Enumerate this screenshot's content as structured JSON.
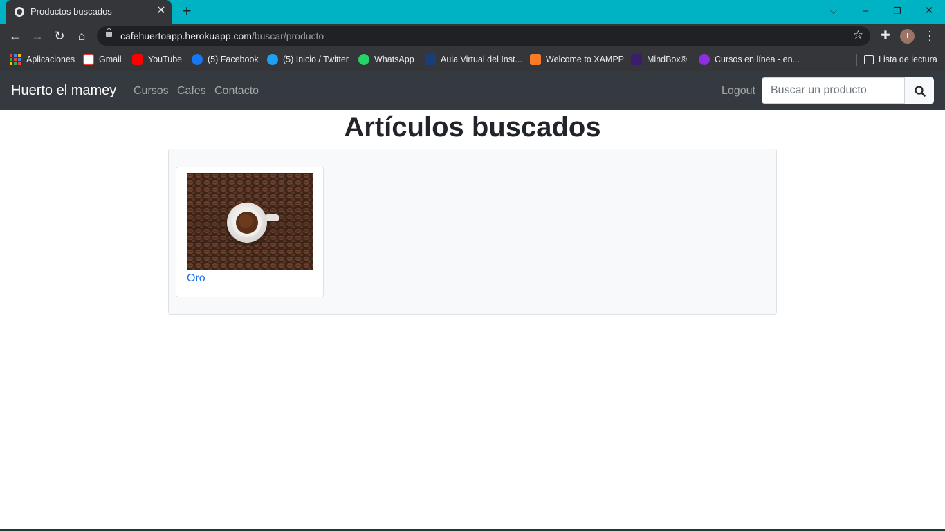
{
  "browser": {
    "tab": {
      "title": "Productos buscados"
    },
    "url": {
      "host": "cafehuertoapp.herokuapp.com",
      "path": "/buscar/producto"
    },
    "profile_initial": "I",
    "bookmarks": [
      {
        "label": "Aplicaciones",
        "icon": "apps-grid-icon"
      },
      {
        "label": "Gmail",
        "icon": "gmail-icon",
        "color": "#ea4335"
      },
      {
        "label": "YouTube",
        "icon": "youtube-icon",
        "color": "#ff0000"
      },
      {
        "label": "(5) Facebook",
        "icon": "facebook-icon",
        "color": "#1877f2"
      },
      {
        "label": "(5) Inicio / Twitter",
        "icon": "twitter-icon",
        "color": "#1da1f2"
      },
      {
        "label": "WhatsApp",
        "icon": "whatsapp-icon",
        "color": "#25d366"
      },
      {
        "label": "Aula Virtual del Inst...",
        "icon": "aula-virtual-icon",
        "color": "#1a3d7c"
      },
      {
        "label": "Welcome to XAMPP",
        "icon": "xampp-icon",
        "color": "#fb7a24"
      },
      {
        "label": "MindBox®",
        "icon": "mindbox-icon",
        "color": "#3b1d6e"
      },
      {
        "label": "Cursos en línea - en...",
        "icon": "cursos-icon",
        "color": "#8e2de2"
      }
    ],
    "reading_list": {
      "label": "Lista de lectura",
      "icon": "reading-list-icon"
    }
  },
  "site": {
    "brand": "Huerto el mamey",
    "nav": [
      {
        "label": "Cursos"
      },
      {
        "label": "Cafes"
      },
      {
        "label": "Contacto"
      }
    ],
    "logout": "Logout",
    "search": {
      "placeholder": "Buscar un producto",
      "value": ""
    }
  },
  "main": {
    "title": "Artículos buscados",
    "products": [
      {
        "name": "Oro",
        "image": "coffee-cup-on-beans-image"
      }
    ]
  },
  "colors": {
    "tabstrip": "#00b3c4",
    "navbar": "#343a40",
    "link": "#1a73e8"
  }
}
